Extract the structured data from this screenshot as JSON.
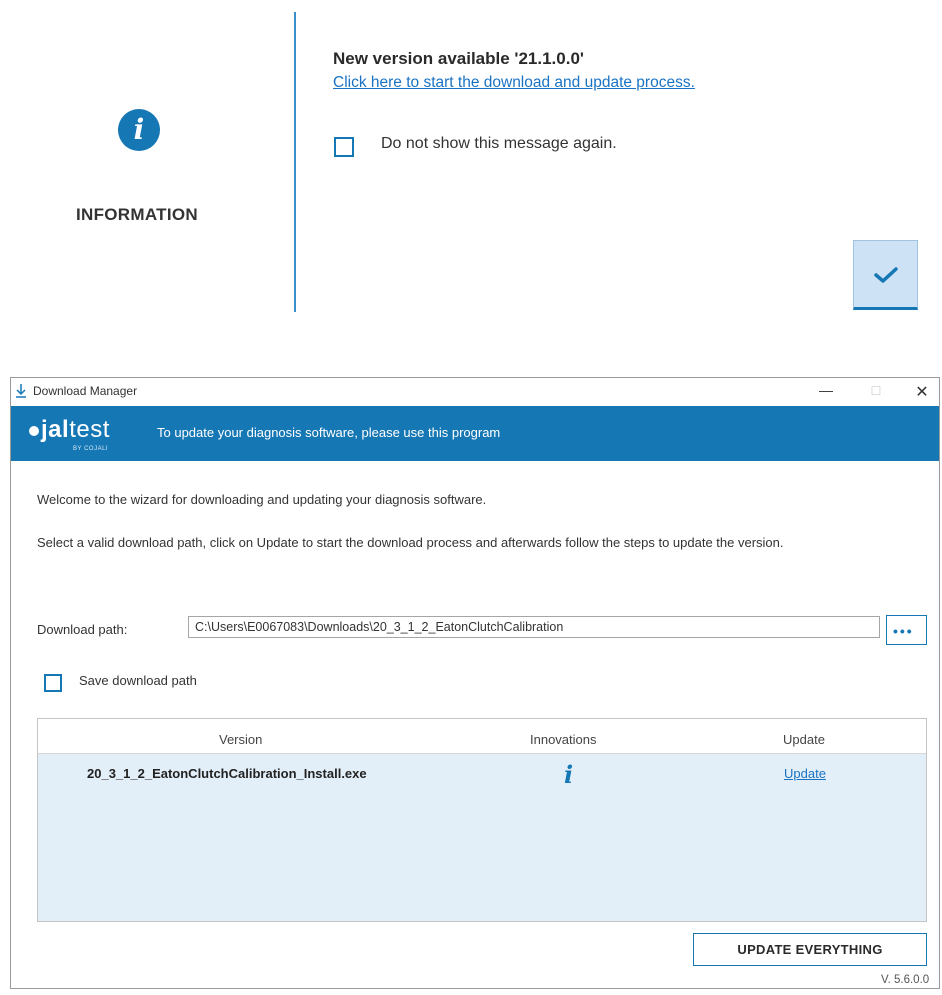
{
  "info_dialog": {
    "icon": "info-icon",
    "label": "INFORMATION",
    "title": "New version available  '21.1.0.0'",
    "link_text": "Click here to start the download and update process.",
    "checkbox_label": "Do not show this message again.",
    "checkbox_checked": false,
    "ok_icon": "checkmark-icon"
  },
  "download_manager": {
    "window_title": "Download Manager",
    "title_icon": "download-arrow-icon",
    "window_controls": {
      "minimize": "—",
      "maximize": "☐",
      "close": "✕"
    },
    "logo": {
      "bold": "jal",
      "light": "test",
      "sub": "BY COJALI"
    },
    "banner_text": "To update your diagnosis software, please use this program",
    "welcome": "Welcome to the wizard for downloading and updating your diagnosis software.",
    "instructions": "Select a valid download path, click on Update to start the download process and afterwards follow the steps to update the version.",
    "download_path_label": "Download path:",
    "download_path_value": "C:\\Users\\E0067083\\Downloads\\20_3_1_2_EatonClutchCalibration",
    "browse_label": "•••",
    "save_path_label": "Save download path",
    "save_path_checked": false,
    "table": {
      "headers": {
        "version": "Version",
        "innovations": "Innovations",
        "update": "Update"
      },
      "rows": [
        {
          "version": "20_3_1_2_EatonClutchCalibration_Install.exe",
          "innovations_icon": "info-icon",
          "update": "Update"
        }
      ]
    },
    "update_everything_label": "UPDATE EVERYTHING",
    "app_version": "V. 5.6.0.0"
  },
  "colors": {
    "accent": "#1677b5",
    "row_selected": "#e3eff8",
    "link": "#1a73c2"
  }
}
